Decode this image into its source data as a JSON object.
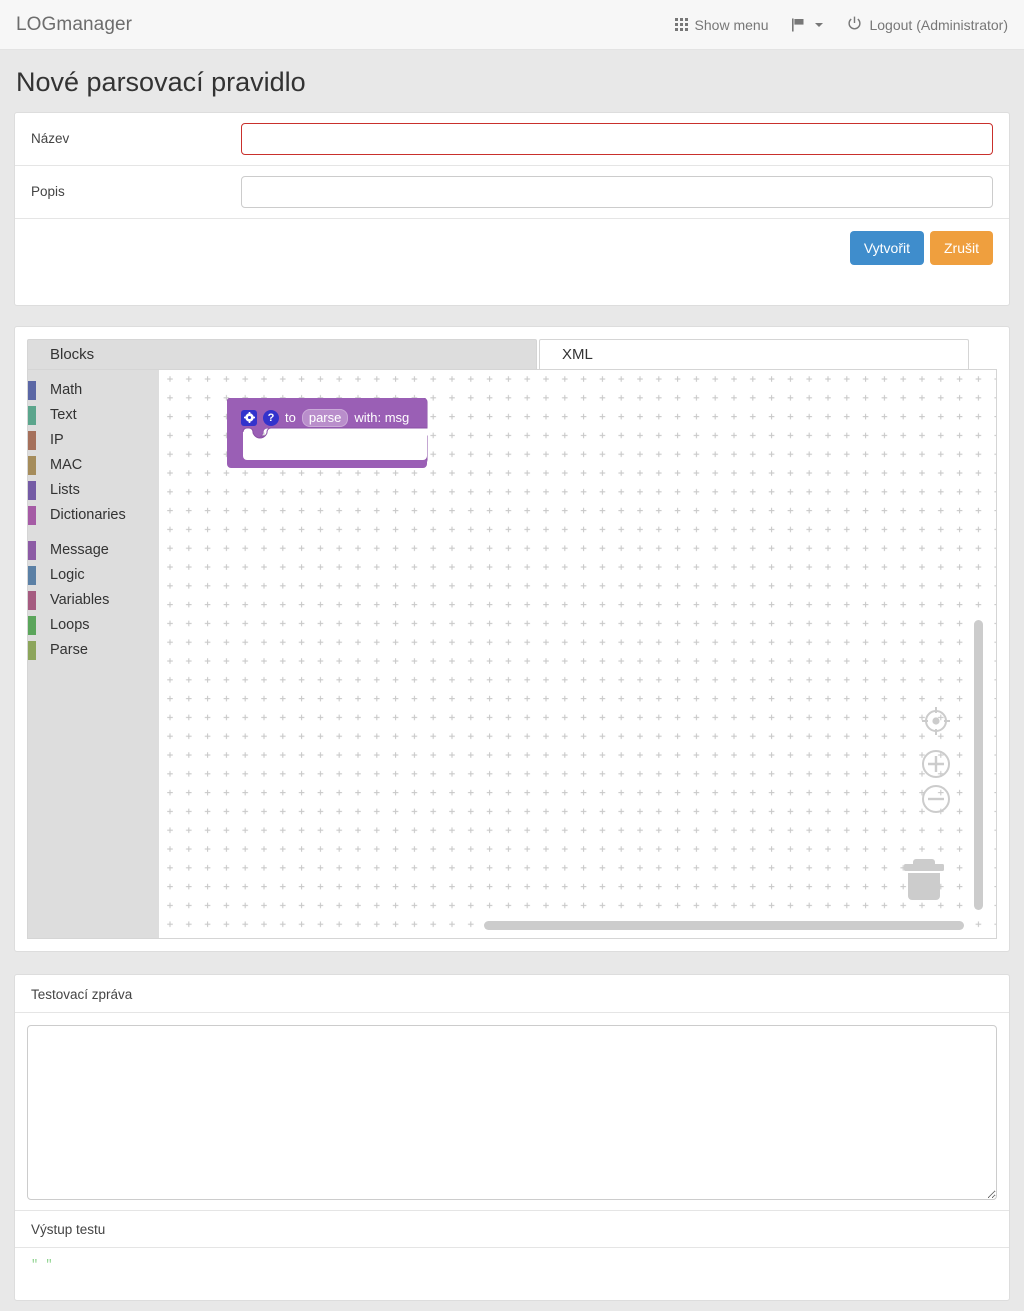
{
  "navbar": {
    "brand": "LOGmanager",
    "show_menu": "Show menu",
    "logout": "Logout (Administrator)",
    "icons": {
      "menu": "grid-icon",
      "flag": "flag-icon",
      "power": "power-icon"
    }
  },
  "page": {
    "title": "Nové parsovací pravidlo"
  },
  "form": {
    "name_label": "Název",
    "name_value": "",
    "name_placeholder": "",
    "desc_label": "Popis",
    "desc_value": "",
    "desc_placeholder": "",
    "submit_label": "Vytvořit",
    "cancel_label": "Zrušit",
    "submit_color": "#3f8dcc",
    "cancel_color": "#ef9f3e",
    "invalid_border_color": "#c9302c"
  },
  "editor": {
    "tabs": [
      {
        "label": "Blocks",
        "active": true
      },
      {
        "label": "XML",
        "active": false
      }
    ],
    "toolbox": [
      {
        "label": "Math",
        "color": "#5b67a5"
      },
      {
        "label": "Text",
        "color": "#5ba58c"
      },
      {
        "label": "IP",
        "color": "#a5705b"
      },
      {
        "label": "MAC",
        "color": "#a58c5b"
      },
      {
        "label": "Lists",
        "color": "#745ba5"
      },
      {
        "label": "Dictionaries",
        "color": "#a55ba5"
      },
      {
        "label": "Message",
        "color": "#8c5ba5"
      },
      {
        "label": "Logic",
        "color": "#5b80a5"
      },
      {
        "label": "Variables",
        "color": "#a55b80"
      },
      {
        "label": "Loops",
        "color": "#5ba55b"
      },
      {
        "label": "Parse",
        "color": "#8ca55b"
      }
    ],
    "block": {
      "color": "#9a5fb5",
      "mutator_icon": "gear-icon",
      "help_icon": "question-mark-icon",
      "text_to": "to",
      "field_name": "parse",
      "text_with": "with: msg"
    },
    "controls": {
      "center": "crosshair-target-icon",
      "zoom_in": "plus-icon",
      "zoom_out": "minus-icon",
      "trash": "trash-can-icon"
    }
  },
  "test": {
    "message_label": "Testovací zpráva",
    "message_value": "",
    "message_placeholder": "",
    "output_label": "Výstup testu",
    "output_value": "\" \"",
    "output_color": "#8ad18a"
  }
}
